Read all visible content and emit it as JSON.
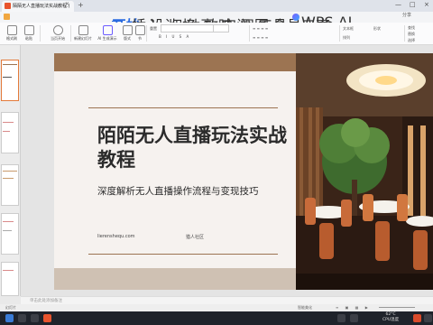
{
  "window": {
    "doc_tab_title": "陌陌无人直播玩法实战教程.(",
    "new_tab": "+",
    "tab_close": "×",
    "minimize": "—",
    "maximize": "□",
    "close": "×"
  },
  "menu": {
    "items": [
      "开始",
      "插入",
      "设计",
      "切换",
      "动画",
      "放映",
      "审阅",
      "视图",
      "工具",
      "会员专享"
    ],
    "active": "开始",
    "wps_ai": "WPS AI",
    "share": "分享"
  },
  "ribbon": {
    "format_painter": "格式刷",
    "paste": "粘贴",
    "current_start": "当页开始",
    "new_slide": "新建幻灯片",
    "ai_generate": "AI 生成演示",
    "layout": "版式",
    "section": "节",
    "reset": "重置",
    "textbox": "文本框",
    "shape": "形状",
    "arrange": "排列",
    "find": "查找",
    "replace": "替换",
    "select": "选择"
  },
  "slide": {
    "title": "陌陌无人直播玩法实战教程",
    "subtitle": "深度解析无人直播操作流程与变现技巧",
    "url": "lierenshequ.com",
    "org": "猎人社区"
  },
  "notes": {
    "placeholder": "单击此处添加备注"
  },
  "status": {
    "label": "幻灯片",
    "smart_beautify": "智能美化"
  },
  "tray": {
    "temp": "62°C",
    "cpu": "CPU温度"
  },
  "colors": {
    "brand_brown": "#9c7452",
    "accent_blue": "#2b6be0",
    "ppt_icon": "#e8542e"
  }
}
